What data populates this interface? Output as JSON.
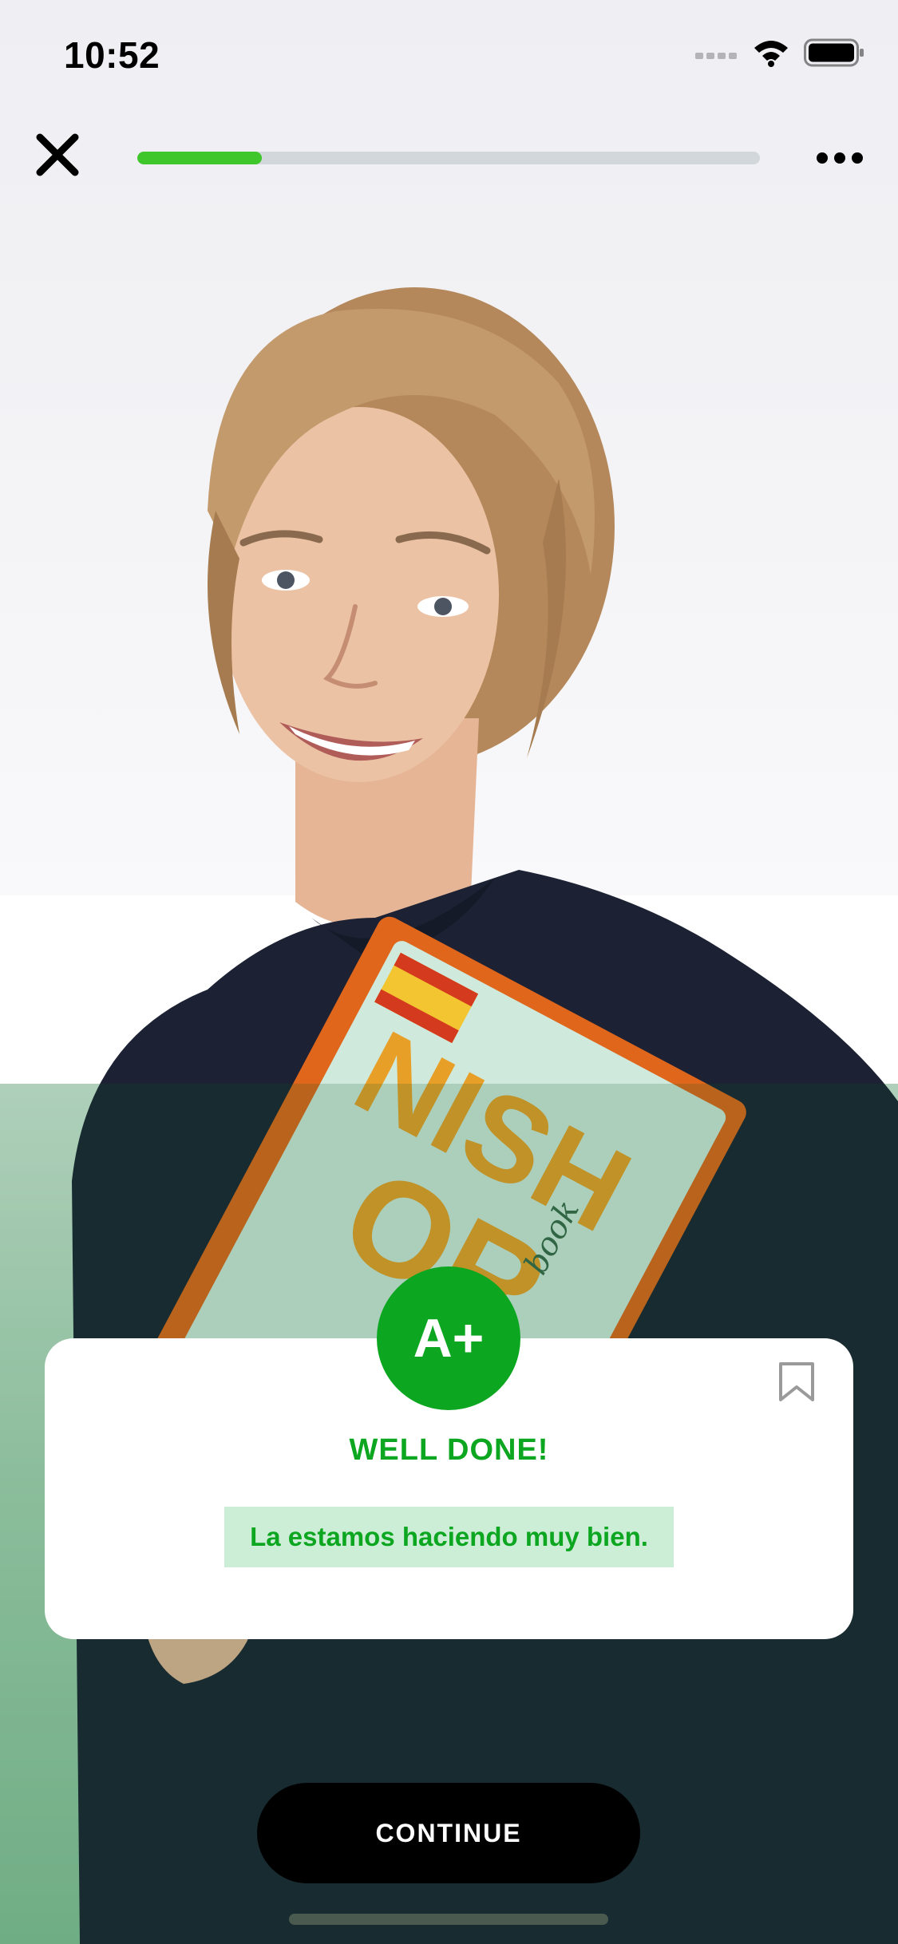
{
  "status_bar": {
    "time": "10:52",
    "icons": [
      "signal-icon",
      "wifi-icon",
      "battery-icon"
    ]
  },
  "top_nav": {
    "close_icon": "close-icon",
    "more_icon": "more-horizontal-icon",
    "progress_fraction": 0.2
  },
  "image": {
    "book_cover_letters": [
      "NISH",
      "OR"
    ],
    "book_script": "book"
  },
  "feedback": {
    "grade": "A+",
    "title": "WELL DONE!",
    "sentence": "La estamos haciendo muy bien.",
    "bookmark_icon": "bookmark-icon"
  },
  "actions": {
    "continue_label": "CONTINUE"
  },
  "colors": {
    "accent_green": "#0ca620",
    "progress_green": "#3ec62a",
    "highlight_bg": "#cdeed6",
    "button_black": "#000000"
  }
}
